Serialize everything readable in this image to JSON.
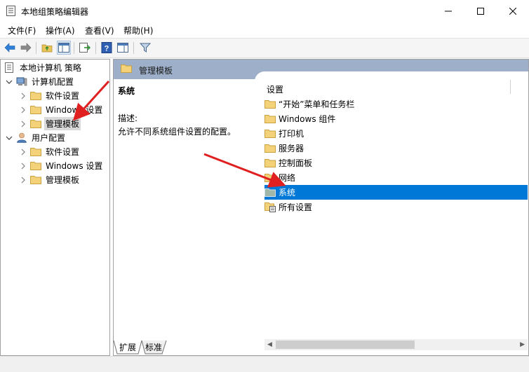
{
  "window": {
    "title": "本地组策略编辑器",
    "minimize_icon": "minimize-icon",
    "maximize_icon": "maximize-icon",
    "close_icon": "close-icon"
  },
  "menu": [
    "文件(F)",
    "操作(A)",
    "查看(V)",
    "帮助(H)"
  ],
  "toolbar": [
    "back-icon",
    "forward-icon",
    "up-folder-icon",
    "show-hide-tree-icon",
    "export-list-icon",
    "help-icon",
    "properties-pane-icon",
    "filter-icon"
  ],
  "tree": {
    "root": "本地计算机 策略",
    "computer_config": "计算机配置",
    "computer_children": [
      "软件设置",
      "Windows 设置",
      "管理模板"
    ],
    "user_config": "用户配置",
    "user_children": [
      "软件设置",
      "Windows 设置",
      "管理模板"
    ]
  },
  "right": {
    "header": "管理模板",
    "desc_title": "系统",
    "desc_label": "描述:",
    "desc_text": "允许不同系统组件设置的配置。",
    "column": "设置",
    "items": [
      "“开始”菜单和任务栏",
      "Windows 组件",
      "打印机",
      "服务器",
      "控制面板",
      "网络",
      "系统",
      "所有设置"
    ],
    "selected_index": 6
  },
  "tabs": [
    "扩展",
    "标准"
  ],
  "colors": {
    "header": "#9dafc9",
    "selection": "#0078d7",
    "annotation_arrow": "#e02020"
  }
}
